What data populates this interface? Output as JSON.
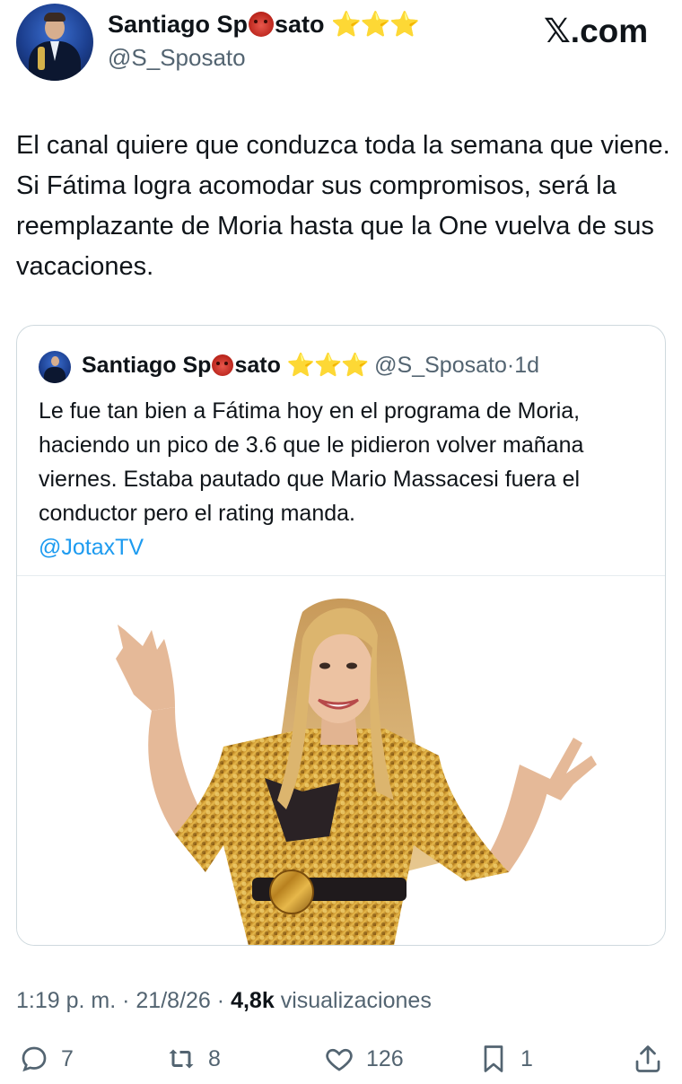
{
  "header": {
    "display_name_prefix": "Santiago Sp",
    "display_name_suffix": "sato",
    "name_emoji": "devil-face-icon",
    "badge_stars": "⭐⭐⭐",
    "handle": "@S_Sposato",
    "site_label": "𝕏.com"
  },
  "tweet": {
    "text": "El canal quiere que conduzca toda la semana que viene. Si Fátima logra acomodar sus compromisos, será la reemplazante de Moria hasta que la One vuelva de sus vacaciones."
  },
  "quote": {
    "display_name_prefix": "Santiago Sp",
    "display_name_suffix": "sato",
    "badge_stars": "⭐⭐⭐",
    "handle": "@S_Sposato",
    "separator": "·",
    "age": "1d",
    "text": "Le fue tan bien a Fátima hoy en el programa de Moria, haciendo un pico de 3.6 que le pidieron volver mañana viernes. Estaba pautado que Mario Massacesi fuera el conductor pero el rating manda.",
    "mention": "@JotaxTV"
  },
  "meta": {
    "time": "1:19 p. m.",
    "sep1": "·",
    "date": "21/8/26",
    "sep2": "·",
    "views_count": "4,8k",
    "views_label": "visualizaciones"
  },
  "actions": {
    "replies": "7",
    "reposts": "8",
    "likes": "126",
    "bookmarks": "1"
  },
  "colors": {
    "text": "#0f1419",
    "secondary": "#536471",
    "link": "#1d9bf0",
    "border": "#cfd9de",
    "star": "#f2c230"
  }
}
